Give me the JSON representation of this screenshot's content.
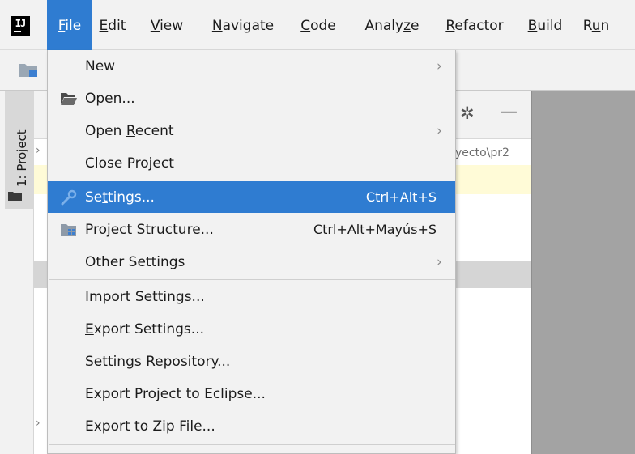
{
  "menubar": {
    "items": [
      {
        "mnemonic": "F",
        "rest": "ile"
      },
      {
        "mnemonic": "E",
        "rest": "dit"
      },
      {
        "mnemonic": "V",
        "rest": "iew"
      },
      {
        "mnemonic": "N",
        "rest": "avigate"
      },
      {
        "mnemonic": "C",
        "rest": "ode"
      },
      {
        "pre": "Analy",
        "mnemonic": "z",
        "rest": "e"
      },
      {
        "mnemonic": "R",
        "rest": "efactor"
      },
      {
        "mnemonic": "B",
        "rest": "uild"
      },
      {
        "pre": "R",
        "mnemonic": "u",
        "rest": "n"
      }
    ]
  },
  "side_tab": {
    "label": "1: Project"
  },
  "panel": {
    "path": "yecto\\pr2"
  },
  "file_menu": {
    "items": [
      {
        "label": "New"
      },
      {
        "pre": "",
        "mnemonic": "O",
        "rest": "pen..."
      },
      {
        "pre": "Open ",
        "mnemonic": "R",
        "rest": "ecent"
      },
      {
        "label": "Close Project"
      },
      {
        "pre": "Se",
        "mnemonic": "t",
        "rest": "tings...",
        "shortcut": "Ctrl+Alt+S"
      },
      {
        "label": "Project Structure...",
        "shortcut": "Ctrl+Alt+Mayús+S"
      },
      {
        "label": "Other Settings"
      },
      {
        "label": "Import Settings..."
      },
      {
        "pre": "",
        "mnemonic": "E",
        "rest": "xport Settings..."
      },
      {
        "label": "Settings Repository..."
      },
      {
        "label": "Export Project to Eclipse..."
      },
      {
        "label": "Export to Zip File..."
      }
    ]
  },
  "colors": {
    "accent": "#2f7cd1",
    "menu_background": "#f2f2f2",
    "editor_background": "#a3a3a3",
    "highlight_band": "#fffbd7"
  },
  "icons": [
    "intellij-logo",
    "folder-icon",
    "open-folder-icon",
    "wrench-icon",
    "project-structure-icon",
    "gear-icon",
    "minimize-icon",
    "chevron-right-icon"
  ]
}
